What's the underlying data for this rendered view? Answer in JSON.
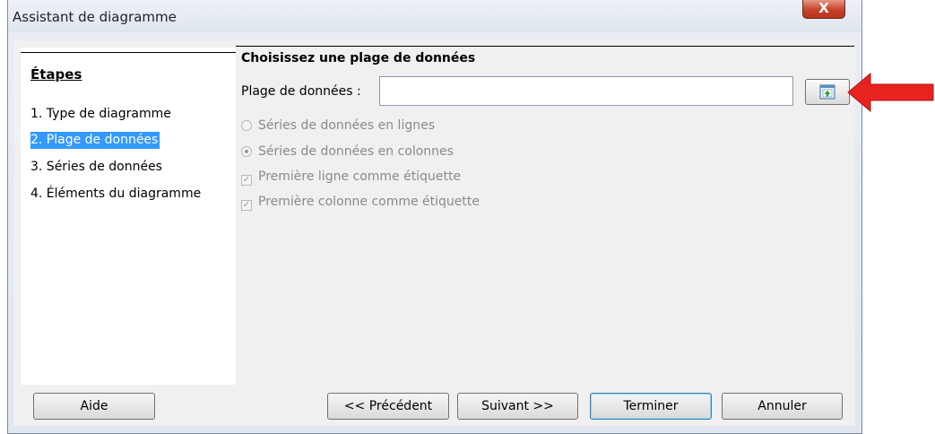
{
  "window": {
    "title": "Assistant de diagramme",
    "close_symbol": "X"
  },
  "steps": {
    "heading": "Étapes",
    "items": [
      {
        "label": "1. Type de diagramme"
      },
      {
        "label": "2. Plage de données"
      },
      {
        "label": "3. Séries de données"
      },
      {
        "label": "4. Éléments du diagramme"
      }
    ],
    "selected_index": 1
  },
  "content": {
    "title": "Choisissez une plage de données",
    "range_label": "Plage de données :",
    "range_value": "",
    "options": {
      "rows": "Séries de données en lignes",
      "columns": "Séries de données en colonnes",
      "first_row": "Première ligne comme étiquette",
      "first_col": "Première colonne comme étiquette"
    },
    "selected_series": "columns",
    "first_row_checked": true,
    "first_col_checked": true
  },
  "buttons": {
    "help": "Aide",
    "back": "<< Précédent",
    "next": "Suivant >>",
    "finish": "Terminer",
    "cancel": "Annuler"
  },
  "colors": {
    "selection": "#3399ff",
    "annotation_arrow": "#e8231f"
  }
}
